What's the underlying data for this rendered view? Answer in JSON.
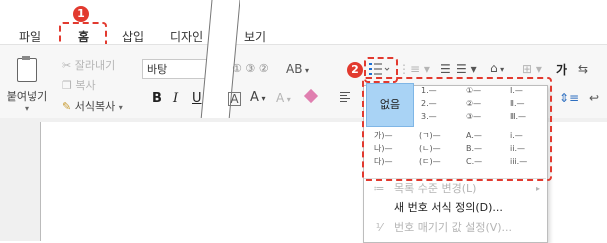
{
  "tabs": {
    "file": "파일",
    "home": "홈",
    "insert": "삽입",
    "design": "디자인",
    "view_partial": "보기"
  },
  "callouts": {
    "one": "1",
    "two": "2"
  },
  "clipboard": {
    "paste": "붙여넣기",
    "cut": "잘라내기",
    "copy": "복사",
    "format_painter": "서식복사"
  },
  "font": {
    "name": "바탕",
    "size_icons": "① ③ ②",
    "sub": "AB",
    "bold": "B",
    "italic": "I",
    "underline": "U",
    "box_a": "A",
    "char_a": "A",
    "hl_a": "A"
  },
  "paragraph": {
    "list_button_icon": "list-bullets-icon",
    "font_color": "가",
    "wrap": "↩"
  },
  "numbering": {
    "none": "없음",
    "cells": [
      [
        "1.—",
        "2.—",
        "3.—"
      ],
      [
        "①—",
        "②—",
        "③—"
      ],
      [
        "Ⅰ.—",
        "Ⅱ.—",
        "Ⅲ.—"
      ],
      [
        "가)—",
        "나)—",
        "다)—"
      ],
      [
        "(ㄱ)—",
        "(ㄴ)—",
        "(ㄷ)—"
      ],
      [
        "A.—",
        "B.—",
        "C.—"
      ],
      [
        "i.—",
        "ii.—",
        "iii.—"
      ]
    ]
  },
  "menu": {
    "change_level": "목록 수준 변경(L)",
    "define_new": "새 번호 서식 정의(D)...",
    "set_value": "번호 매기기 값 설정(V)..."
  }
}
